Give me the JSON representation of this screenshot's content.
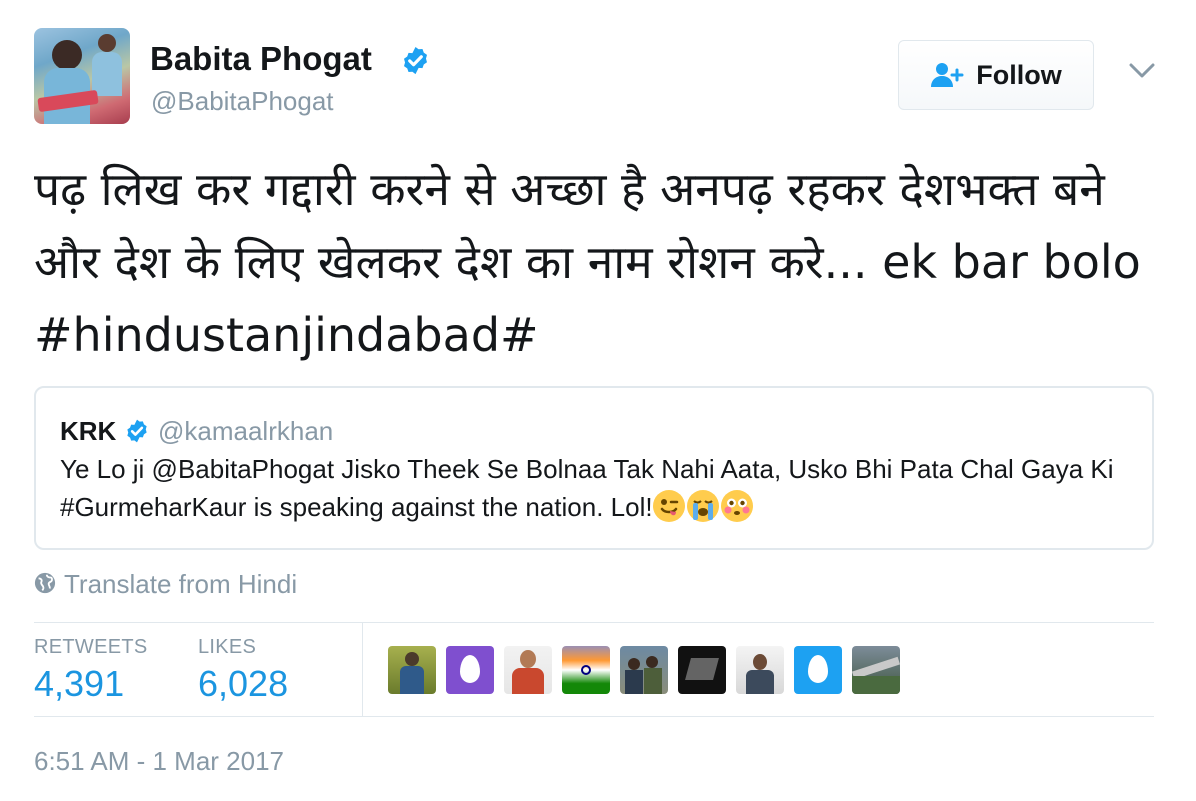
{
  "author": {
    "name": "Babita Phogat",
    "handle": "@BabitaPhogat",
    "verified": true
  },
  "follow_button": {
    "label": "Follow",
    "icon": "add-user-icon"
  },
  "tweet": {
    "text": "पढ़ लिख कर गद्दारी करने से अच्छा है अनपढ़ रहकर देशभक्त बने और देश के लिए खेलकर देश का नाम रोशन करे... ek bar bolo #hindustanjindabad#"
  },
  "quoted_tweet": {
    "name": "KRK",
    "handle": "@kamaalrkhan",
    "verified": true,
    "text": "Ye Lo ji @BabitaPhogat Jisko Theek Se Bolnaa Tak Nahi Aata, Usko Bhi Pata Chal Gaya Ki #GurmeharKaur is speaking against the nation. Lol!",
    "emojis": [
      "winking-tongue-emoji",
      "loudly-crying-emoji",
      "flushed-emoji"
    ]
  },
  "translate": {
    "label": "Translate from Hindi",
    "icon": "globe-icon"
  },
  "stats": {
    "retweets_label": "RETWEETS",
    "retweets_value": "4,391",
    "likes_label": "LIKES",
    "likes_value": "6,028"
  },
  "likers": [
    {
      "kind": "photo"
    },
    {
      "kind": "default-egg"
    },
    {
      "kind": "photo"
    },
    {
      "kind": "flag-photo"
    },
    {
      "kind": "photo"
    },
    {
      "kind": "dark-logo"
    },
    {
      "kind": "photo"
    },
    {
      "kind": "default-egg"
    },
    {
      "kind": "photo"
    }
  ],
  "timestamp": "6:51 AM - 1 Mar 2017",
  "colors": {
    "accent": "#1b95e0",
    "verified": "#1da1f2",
    "muted": "#8899a6",
    "border": "#e1e8ed"
  }
}
